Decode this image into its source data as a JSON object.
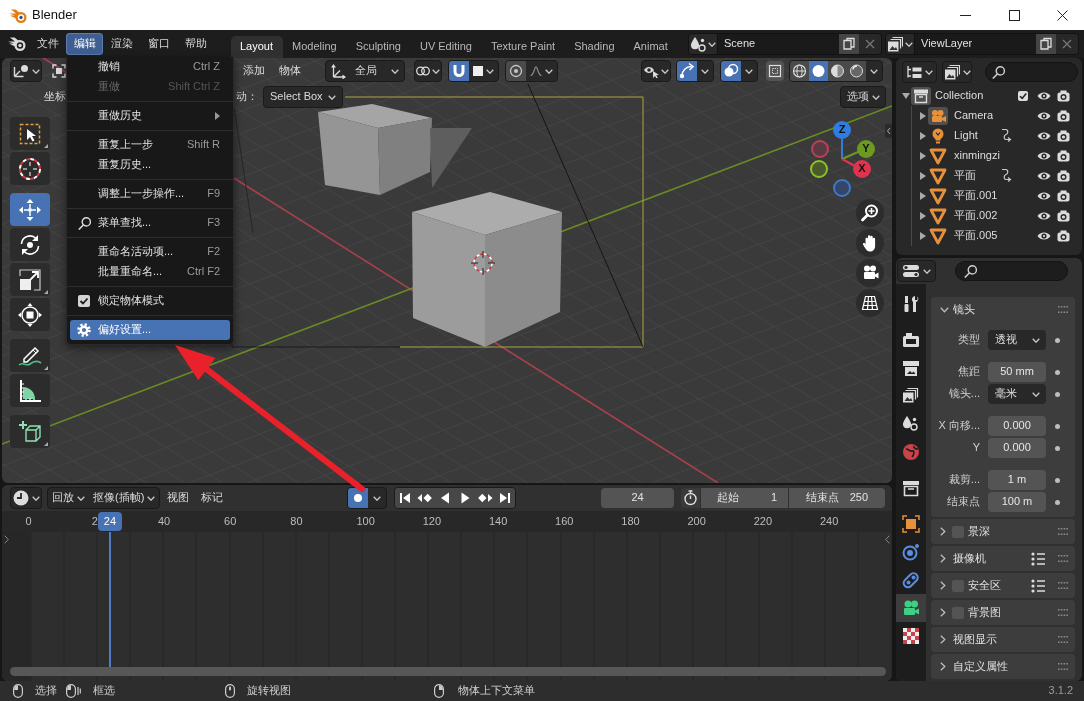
{
  "window": {
    "title": "Blender"
  },
  "menubar": [
    {
      "label": "文件",
      "selected": false
    },
    {
      "label": "编辑",
      "selected": true
    },
    {
      "label": "渲染",
      "selected": false
    },
    {
      "label": "窗口",
      "selected": false
    },
    {
      "label": "帮助",
      "selected": false
    }
  ],
  "workspace_tabs": [
    {
      "label": "Layout",
      "selected": true
    },
    {
      "label": "Modeling",
      "selected": false
    },
    {
      "label": "Sculpting",
      "selected": false
    },
    {
      "label": "UV Editing",
      "selected": false
    },
    {
      "label": "Texture Paint",
      "selected": false
    },
    {
      "label": "Shading",
      "selected": false
    },
    {
      "label": "Animat",
      "selected": false
    }
  ],
  "scene_selector": {
    "value": "Scene"
  },
  "view_layer_selector": {
    "value": "ViewLayer"
  },
  "viewport": {
    "header": {
      "menus": [
        "添加",
        "物体"
      ],
      "orientation": "全局",
      "snap_on": true,
      "proportional_on": false,
      "gizmos_on": true,
      "overlays_on": true,
      "xray_on": false,
      "shading_modes": [
        {
          "kind": "wireframe",
          "selected": false
        },
        {
          "kind": "solid",
          "selected": true
        },
        {
          "kind": "material",
          "selected": false
        },
        {
          "kind": "rendered",
          "selected": false
        }
      ]
    },
    "tool_settings": {
      "label_1": "坐标",
      "label_2": "动：",
      "drag_value": "Select Box",
      "options": "选项"
    },
    "tool_groups": [
      [
        {
          "kind": "select_box",
          "selected": false,
          "more": true
        },
        {
          "kind": "cursor",
          "selected": false
        }
      ],
      [
        {
          "kind": "move",
          "selected": true
        },
        {
          "kind": "rotate",
          "selected": false
        },
        {
          "kind": "scale",
          "selected": false,
          "more": true
        },
        {
          "kind": "transform",
          "selected": false
        }
      ],
      [
        {
          "kind": "annotate",
          "selected": false,
          "more": true
        },
        {
          "kind": "measure",
          "selected": false
        }
      ],
      [
        {
          "kind": "add_cube",
          "selected": false,
          "more": true
        }
      ]
    ],
    "gizmo_axes": [
      "Z",
      "Y",
      "X"
    ]
  },
  "edit_menu": [
    {
      "kind": "item",
      "label": "撤销",
      "shortcut": "Ctrl Z",
      "disabled": false,
      "selected": false
    },
    {
      "kind": "item",
      "label": "重做",
      "shortcut": "Shift Ctrl Z",
      "disabled": true,
      "selected": false
    },
    {
      "kind": "separator"
    },
    {
      "kind": "submenu",
      "label": "重做历史",
      "disabled": false,
      "selected": false
    },
    {
      "kind": "separator"
    },
    {
      "kind": "item",
      "label": "重复上一步",
      "shortcut": "Shift R",
      "disabled": false,
      "selected": false
    },
    {
      "kind": "item",
      "label": "重复历史...",
      "disabled": false,
      "selected": false
    },
    {
      "kind": "separator"
    },
    {
      "kind": "item",
      "label": "调整上一步操作...",
      "shortcut": "F9",
      "disabled": false,
      "selected": false
    },
    {
      "kind": "separator"
    },
    {
      "kind": "search",
      "label": "菜单查找...",
      "shortcut": "F3",
      "disabled": false,
      "selected": false
    },
    {
      "kind": "separator"
    },
    {
      "kind": "item",
      "label": "重命名活动项...",
      "shortcut": "F2",
      "disabled": false,
      "selected": false
    },
    {
      "kind": "item",
      "label": "批量重命名...",
      "shortcut": "Ctrl F2",
      "disabled": false,
      "selected": false
    },
    {
      "kind": "separator"
    },
    {
      "kind": "checkbox",
      "label": "锁定物体模式",
      "checked": true,
      "disabled": false,
      "selected": false
    },
    {
      "kind": "separator"
    },
    {
      "kind": "settings",
      "label": "偏好设置...",
      "disabled": false,
      "selected": true
    }
  ],
  "outliner": {
    "tree": [
      {
        "name": "Collection",
        "kind": "collection",
        "expanded": true,
        "active": true,
        "checked": true,
        "visible": true,
        "children": [
          {
            "name": "Camera",
            "kind": "camera",
            "expanded": false,
            "active": true,
            "visible": true
          },
          {
            "name": "Light",
            "kind": "light",
            "expanded": false,
            "active": false,
            "linked": true,
            "visible": true
          },
          {
            "name": "xinmingzi",
            "kind": "mesh",
            "expanded": false,
            "active": false,
            "visible": true
          },
          {
            "name": "平面",
            "kind": "mesh",
            "expanded": false,
            "active": false,
            "linked": true,
            "visible": true
          },
          {
            "name": "平面.001",
            "kind": "mesh",
            "expanded": false,
            "active": false,
            "visible": true
          },
          {
            "name": "平面.002",
            "kind": "mesh",
            "expanded": false,
            "active": false,
            "visible": true
          },
          {
            "name": "平面.005",
            "kind": "mesh",
            "expanded": false,
            "active": false,
            "visible": true
          }
        ]
      }
    ]
  },
  "properties": {
    "tab_groups": [
      [
        {
          "kind": "tool",
          "selected": false
        }
      ],
      [
        {
          "kind": "render",
          "selected": false
        },
        {
          "kind": "output",
          "selected": false
        },
        {
          "kind": "view_layer",
          "selected": false
        },
        {
          "kind": "scene",
          "selected": false
        },
        {
          "kind": "world",
          "selected": false
        }
      ],
      [
        {
          "kind": "collection",
          "selected": false
        }
      ],
      [
        {
          "kind": "object",
          "selected": false
        },
        {
          "kind": "physics",
          "selected": false
        },
        {
          "kind": "constraints",
          "selected": false
        },
        {
          "kind": "data",
          "selected": true
        },
        {
          "kind": "texture",
          "selected": false
        }
      ]
    ],
    "panels": [
      {
        "title": "镜头",
        "kind": "plain",
        "expanded": true,
        "field_groups": [
          [
            {
              "label": "类型",
              "kind": "dropdown",
              "value": "透视"
            }
          ],
          [
            {
              "label": "焦距",
              "kind": "number",
              "value": "50 mm"
            },
            {
              "label": "镜头...",
              "kind": "dropdown",
              "value": "毫米"
            }
          ],
          [
            {
              "label": "X 向移...",
              "kind": "number",
              "value": "0.000"
            },
            {
              "label": "Y",
              "kind": "number",
              "value": "0.000"
            }
          ],
          [
            {
              "label": "裁剪...",
              "kind": "number",
              "value": "1 m"
            },
            {
              "label": "结束点",
              "kind": "number",
              "value": "100 m"
            }
          ]
        ]
      },
      {
        "title": "景深",
        "kind": "toggle",
        "checked": false,
        "expanded": false
      },
      {
        "title": "摄像机",
        "kind": "plain",
        "expanded": false,
        "presets": true
      },
      {
        "title": "安全区",
        "kind": "toggle",
        "checked": false,
        "expanded": false,
        "presets": true
      },
      {
        "title": "背景图",
        "kind": "toggle",
        "checked": false,
        "expanded": false
      },
      {
        "title": "视图显示",
        "kind": "plain",
        "expanded": false
      },
      {
        "title": "自定义属性",
        "kind": "plain",
        "expanded": false
      }
    ]
  },
  "timeline": {
    "menus": [
      {
        "kind": "dropdown",
        "label": "回放"
      },
      {
        "kind": "dropdown",
        "label": "抠像(插帧)"
      },
      {
        "kind": "menu",
        "label": "视图"
      },
      {
        "kind": "menu",
        "label": "标记"
      }
    ],
    "auto_keying_on": true,
    "current_frame": "24",
    "preview_range_on": false,
    "start": {
      "label": "起始",
      "value": "1"
    },
    "end": {
      "label": "结束点",
      "value": "250"
    },
    "ruler_labels": [
      "0",
      "2",
      "40",
      "60",
      "80",
      "100",
      "120",
      "140",
      "160",
      "180",
      "200",
      "220",
      "240"
    ],
    "playhead": "24"
  },
  "status_bar": {
    "hints": [
      {
        "kind": "left",
        "label": "选择"
      },
      {
        "kind": "left_drag",
        "label": "框选"
      },
      {
        "kind": "middle",
        "label": "旋转视图"
      },
      {
        "kind": "right",
        "label": "物体上下文菜单"
      }
    ],
    "version": "3.1.2"
  }
}
